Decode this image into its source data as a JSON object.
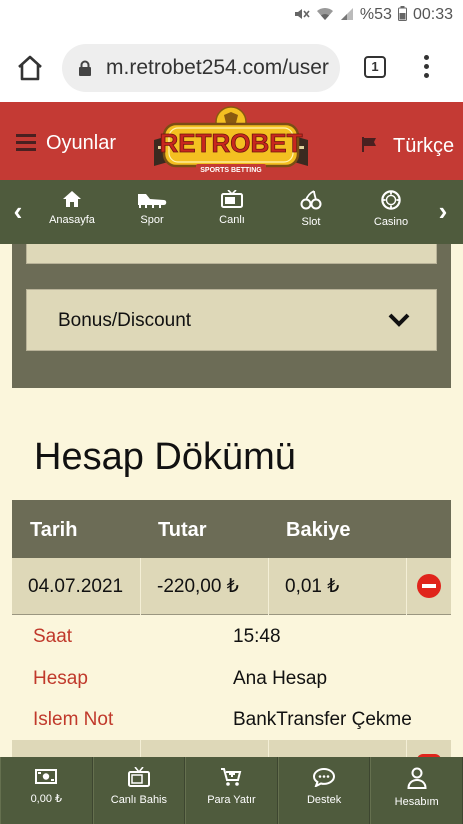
{
  "status_bar": {
    "battery_text": "%53",
    "time": "00:33",
    "icons": [
      "mute-icon",
      "wifi-icon",
      "signal-icon",
      "battery-icon"
    ]
  },
  "browser": {
    "url": "m.retrobet254.com/user",
    "tab_count": "1",
    "icons": [
      "home-icon",
      "lock-icon",
      "more-vert-icon"
    ]
  },
  "header": {
    "games_label": "Oyunlar",
    "logo_text": "RETROBET",
    "logo_subtext": "SPORTS BETTING",
    "language_label": "Türkçe",
    "brand_colors": {
      "header_red": "#c43a34",
      "nav_green": "#4f5b3d",
      "logo_yellow": "#f4c021"
    }
  },
  "nav": {
    "items": [
      {
        "label": "Anasayfa",
        "icon": "home-icon"
      },
      {
        "label": "Spor",
        "icon": "cleat-icon"
      },
      {
        "label": "Canlı",
        "icon": "tv-icon"
      },
      {
        "label": "Slot",
        "icon": "cherry-icon"
      },
      {
        "label": "Casino",
        "icon": "chip-icon"
      }
    ]
  },
  "filters": {
    "bonus_label": "Bonus/Discount"
  },
  "page": {
    "title": "Hesap Dökümü"
  },
  "table": {
    "headers": [
      "Tarih",
      "Tutar",
      "Bakiye"
    ],
    "rows": [
      {
        "date": "04.07.2021",
        "amount": "-220,00 ₺",
        "balance": "0,01 ₺",
        "details": [
          {
            "label": "Saat",
            "value": "15:48"
          },
          {
            "label": "Hesap",
            "value": "Ana Hesap"
          },
          {
            "label": "Islem Not",
            "value": "BankTransfer Çekme"
          }
        ]
      }
    ]
  },
  "bottom_bar": {
    "items": [
      {
        "label": "0,00 ₺",
        "icon": "cash-icon"
      },
      {
        "label": "Canlı Bahis",
        "icon": "tv-icon"
      },
      {
        "label": "Para Yatır",
        "icon": "cart-icon"
      },
      {
        "label": "Destek",
        "icon": "chat-icon"
      },
      {
        "label": "Hesabım",
        "icon": "user-icon"
      }
    ]
  }
}
